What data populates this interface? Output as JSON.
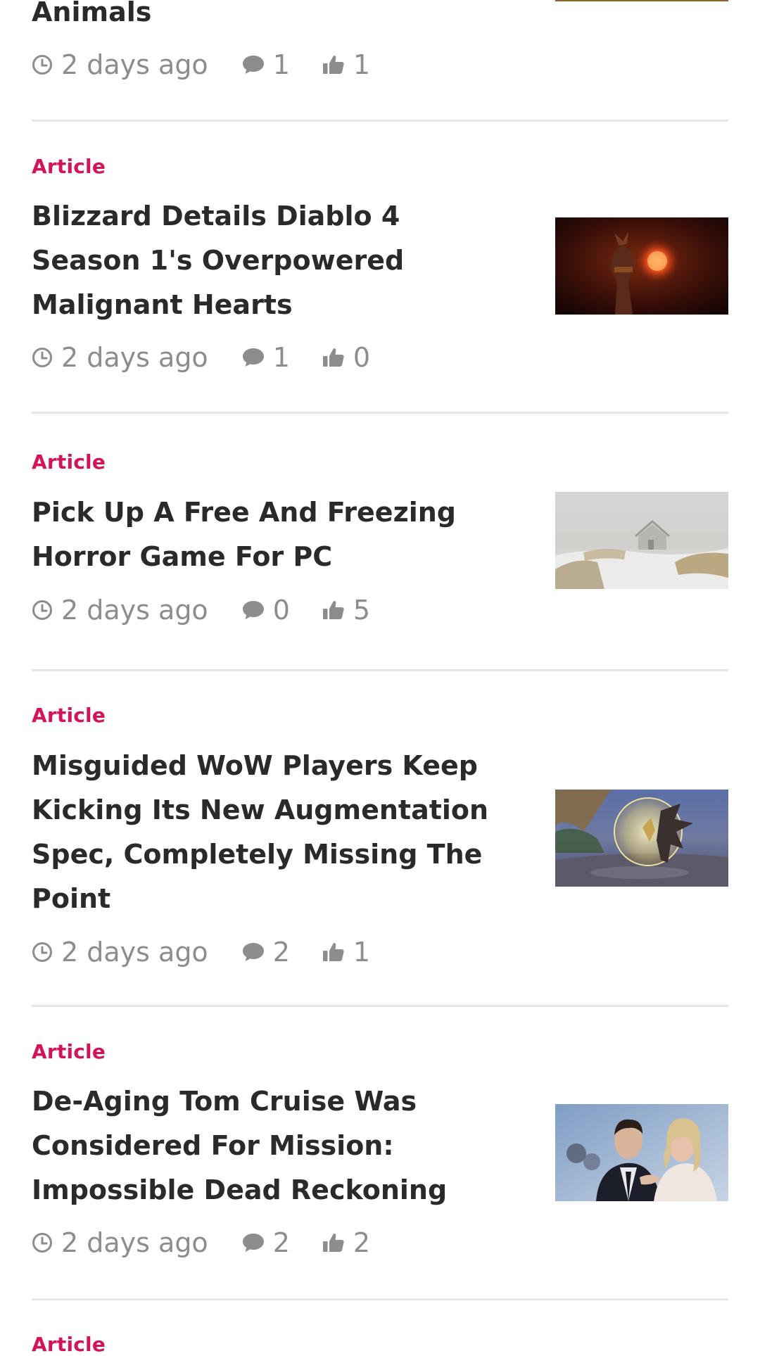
{
  "colors": {
    "category": "#d4145a",
    "meta": "#8d8d8d",
    "title": "#2a2a2a",
    "divider": "#e6e6e6"
  },
  "icons": {
    "time": "clock-icon",
    "comments": "comment-icon",
    "likes": "thumbs-up-icon"
  },
  "articles": [
    {
      "category": "",
      "title": "Animals",
      "time": "2 days ago",
      "comments": "1",
      "likes": "1",
      "thumbnail": "partially visible thumbnail"
    },
    {
      "category": "Article",
      "title": "Blizzard Details Diablo 4 Season 1's Overpowered Malignant Hearts",
      "time": "2 days ago",
      "comments": "1",
      "likes": "0",
      "thumbnail": "dark red demon figure holding glowing heart"
    },
    {
      "category": "Article",
      "title": "Pick Up A Free And Freezing Horror Game For PC",
      "time": "2 days ago",
      "comments": "0",
      "likes": "5",
      "thumbnail": "snowy foggy field with cabin"
    },
    {
      "category": "Article",
      "title": "Misguided WoW Players Keep Kicking Its New Augmentation Spec, Completely Missing The Point",
      "time": "2 days ago",
      "comments": "2",
      "likes": "1",
      "thumbnail": "dragon character inside glowing sphere"
    },
    {
      "category": "Article",
      "title": "De-Aging Tom Cruise Was Considered For Mission: Impossible Dead Reckoning",
      "time": "2 days ago",
      "comments": "2",
      "likes": "2",
      "thumbnail": "man in suit and woman embracing"
    },
    {
      "category": "Article",
      "title": "",
      "time": "",
      "comments": "",
      "likes": "",
      "thumbnail": ""
    }
  ]
}
